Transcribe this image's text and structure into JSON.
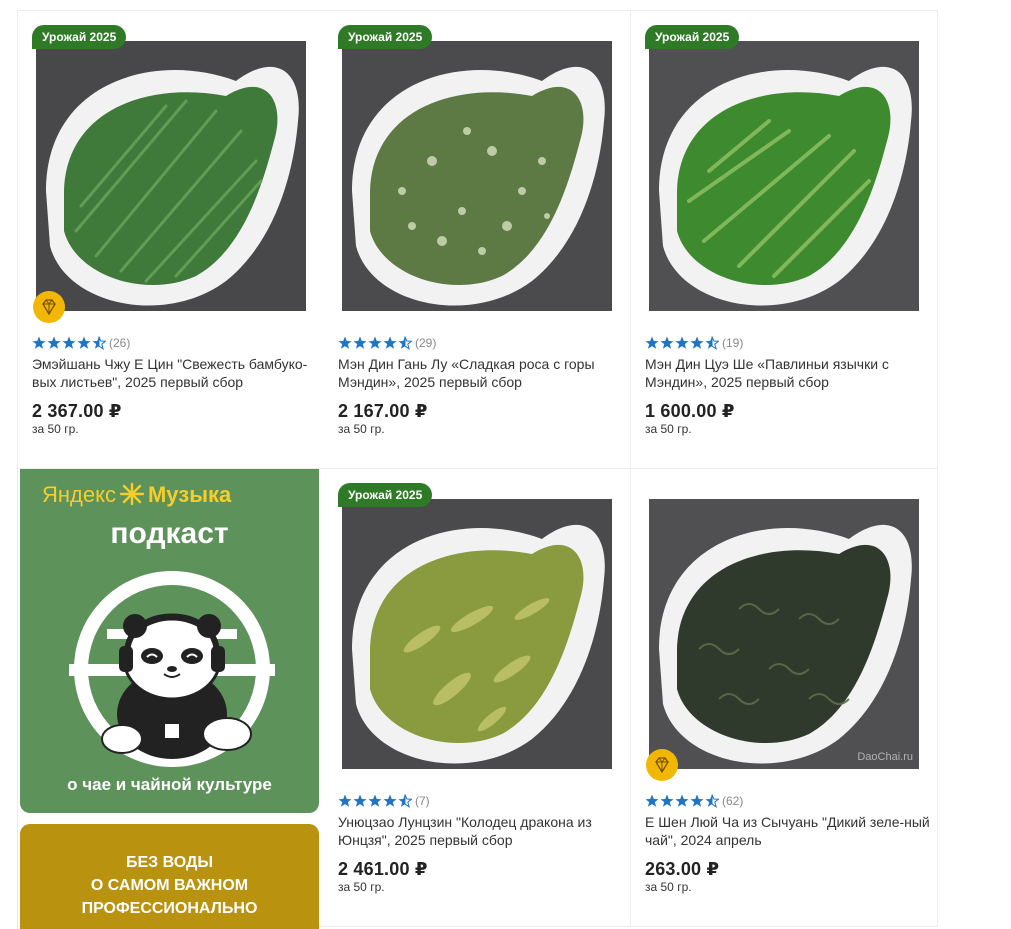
{
  "products": [
    {
      "badge": "Урожай 2025",
      "gem": true,
      "rating_count": "(26)",
      "title": "Эмэйшань Чжу Е Цин \"Свежесть бамбуко-вых листьев\", 2025 первый сбор",
      "price": "2 367.00 ₽",
      "unit": "за 50 гр.",
      "leaf": "#3f7a3a",
      "leaf2": "#6aa35a"
    },
    {
      "badge": "Урожай 2025",
      "gem": false,
      "rating_count": "(29)",
      "title": "Мэн Дин Гань Лу «Сладкая роса с горы Мэндин», 2025 первый сбор",
      "price": "2 167.00 ₽",
      "unit": "за 50 гр.",
      "leaf": "#5d7a45",
      "leaf2": "#c8d4b2"
    },
    {
      "badge": "Урожай 2025",
      "gem": false,
      "rating_count": "(19)",
      "title": "Мэн Дин Цуэ Ше «Павлиньи язычки с Мэндин», 2025 первый сбор",
      "price": "1 600.00 ₽",
      "unit": "за 50 гр.",
      "leaf": "#3e8a2e",
      "leaf2": "#8cc063"
    },
    {
      "badge": "Урожай 2025",
      "gem": false,
      "rating_count": "(7)",
      "title": "Унюцзао Лунцзин \"Колодец дракона из Юнцзя\", 2025 первый сбор",
      "price": "2 461.00 ₽",
      "unit": "за 50 гр.",
      "leaf": "#8a9a3e",
      "leaf2": "#c2c46a"
    },
    {
      "badge": "",
      "gem": true,
      "rating_count": "(62)",
      "title": "Е Шен Люй Ча из Сычуань \"Дикий зеле-ный чай\", 2024 апрель",
      "price": "263.00 ₽",
      "unit": "за 50 гр.",
      "leaf": "#2f3a2c",
      "leaf2": "#5d6e4a",
      "watermark": "DaoChai.ru"
    }
  ],
  "promo": {
    "brand_left": "Яндекс",
    "brand_right": "Музыка",
    "title": "подкаст",
    "subtitle": "о чае и чайной культуре",
    "bg": "#5e925b",
    "brand_color": "#f7cd2a"
  },
  "banner2": {
    "line1": "БЕЗ ВОДЫ",
    "line2": "О САМОМ ВАЖНОМ",
    "line3": "ПРОФЕССИОНАЛЬНО",
    "bg": "#b9920f"
  },
  "colors": {
    "badge_bg": "#2f7a26",
    "star": "#1f74c3",
    "gem": "#f2b705"
  },
  "icons": {
    "rating": "star-icon",
    "premium": "diamond-icon"
  }
}
